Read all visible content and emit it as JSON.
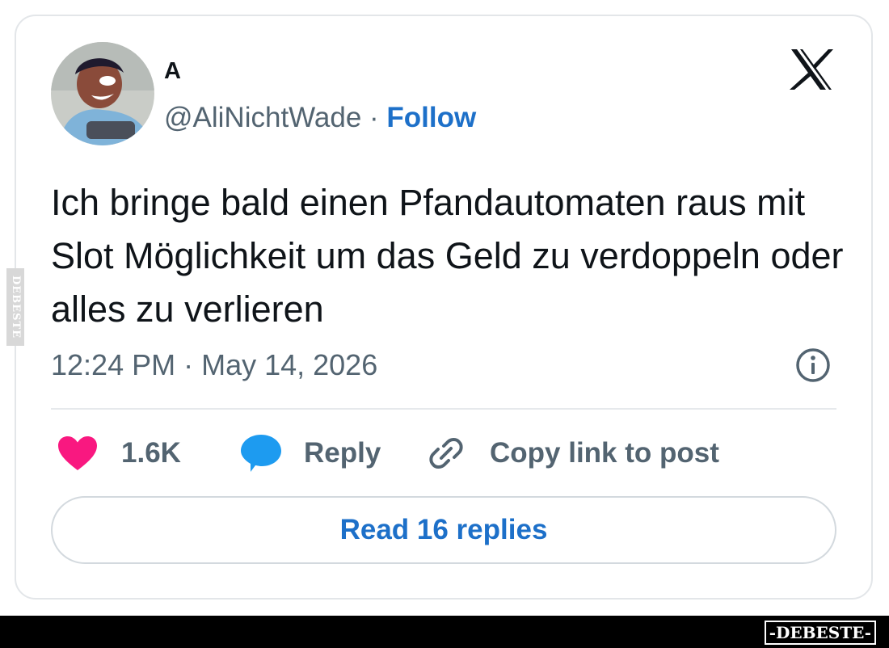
{
  "tweet": {
    "display_name": "A",
    "handle": "@AliNichtWade",
    "separator": " · ",
    "follow_label": "Follow",
    "text": "Ich bringe bald einen Pfandautomaten raus mit Slot Möglichkeit um das Geld zu verdoppeln oder alles zu verlieren",
    "timestamp": "12:24 PM · May 14, 2026"
  },
  "actions": {
    "like_count": "1.6K",
    "reply_label": "Reply",
    "copy_label": "Copy link to post"
  },
  "read_replies_label": "Read 16 replies",
  "watermark": {
    "side_text": "DEBESTE",
    "footer_logo": "-DEBESTE-"
  },
  "colors": {
    "link_blue": "#1d70c9",
    "heart_pink": "#f91880",
    "reply_blue": "#1d9bf0",
    "secondary_text": "#536471"
  },
  "icons": {
    "brand": "x-logo-icon",
    "like": "heart-icon",
    "reply": "speech-bubble-icon",
    "copy": "link-icon",
    "info": "info-icon"
  }
}
